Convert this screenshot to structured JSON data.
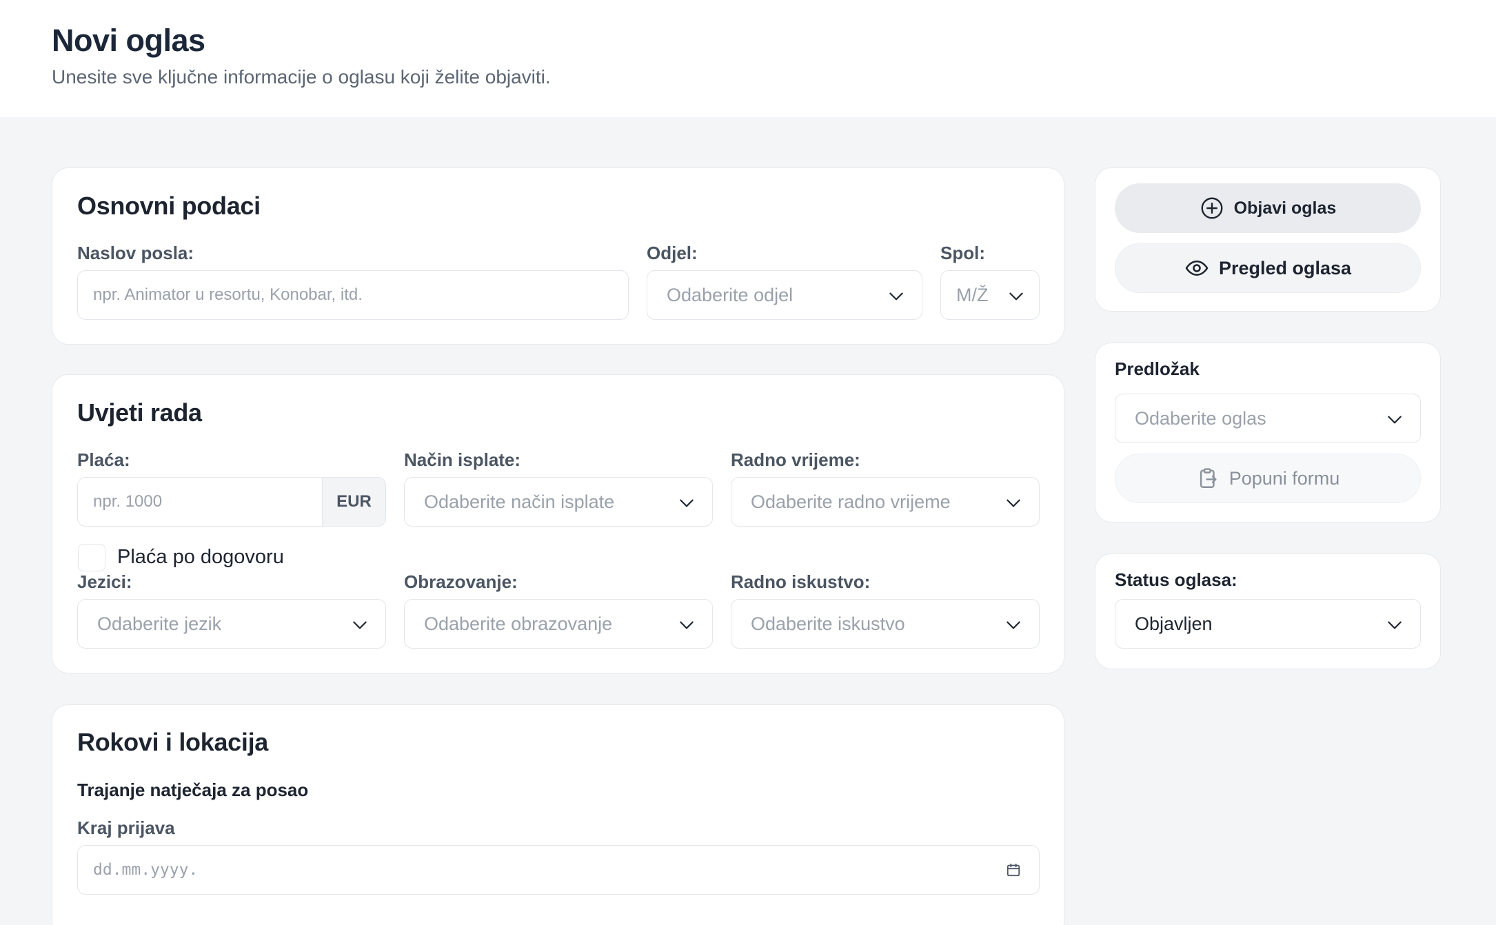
{
  "header": {
    "title": "Novi oglas",
    "subtitle": "Unesite sve ključne informacije o oglasu koji želite objaviti."
  },
  "basic": {
    "title": "Osnovni podaci",
    "job_title_label": "Naslov posla:",
    "job_title_placeholder": "npr. Animator u resortu, Konobar, itd.",
    "department_label": "Odjel:",
    "department_value": "Odaberite odjel",
    "gender_label": "Spol:",
    "gender_value": "M/Ž"
  },
  "conditions": {
    "title": "Uvjeti rada",
    "salary_label": "Plaća:",
    "salary_placeholder": "npr. 1000",
    "salary_currency": "EUR",
    "payment_label": "Način isplate:",
    "payment_value": "Odaberite način isplate",
    "hours_label": "Radno vrijeme:",
    "hours_value": "Odaberite radno vrijeme",
    "negotiable_label": "Plaća po dogovoru",
    "negotiable_checked": false,
    "languages_label": "Jezici:",
    "languages_value": "Odaberite jezik",
    "education_label": "Obrazovanje:",
    "education_value": "Odaberite obrazovanje",
    "experience_label": "Radno iskustvo:",
    "experience_value": "Odaberite iskustvo"
  },
  "deadlines": {
    "title": "Rokovi i lokacija",
    "subtitle": "Trajanje natječaja za posao",
    "end_label": "Kraj prijava",
    "end_placeholder": "dd.mm.yyyy."
  },
  "actions": {
    "publish_label": "Objavi oglas",
    "preview_label": "Pregled oglasa"
  },
  "template": {
    "title": "Predložak",
    "select_value": "Odaberite oglas",
    "fill_label": "Popuni formu"
  },
  "status": {
    "label": "Status oglasa:",
    "value": "Objavljen"
  },
  "icons": {
    "publish": "plus-circle-icon",
    "preview": "eye-icon",
    "fill": "clipboard-icon",
    "dropdown": "chevron-down-icon",
    "date": "calendar-icon"
  }
}
